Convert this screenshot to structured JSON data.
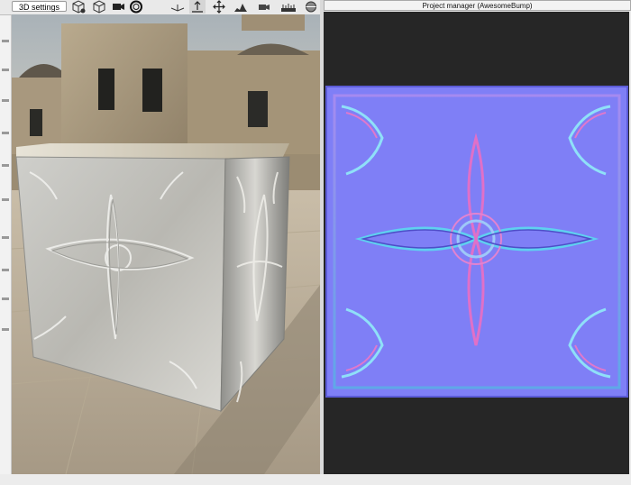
{
  "toolbar": {
    "settings_label": "3D settings",
    "icons": [
      "cube-add-icon",
      "cube-wireframe-icon",
      "camera-icon",
      "ring-icon",
      "tilt-light-icon",
      "arrow-up-icon",
      "move-arrows-icon",
      "histogram-icon",
      "camera-small-icon",
      "ruler-icon",
      "sphere-icon"
    ]
  },
  "project_manager": {
    "title": "Project manager (AwesomeBump)"
  },
  "colors": {
    "normal_map_base": "#7f7ff6",
    "panel_bg": "#262626",
    "toolbar_bg": "#e9e9e9"
  }
}
